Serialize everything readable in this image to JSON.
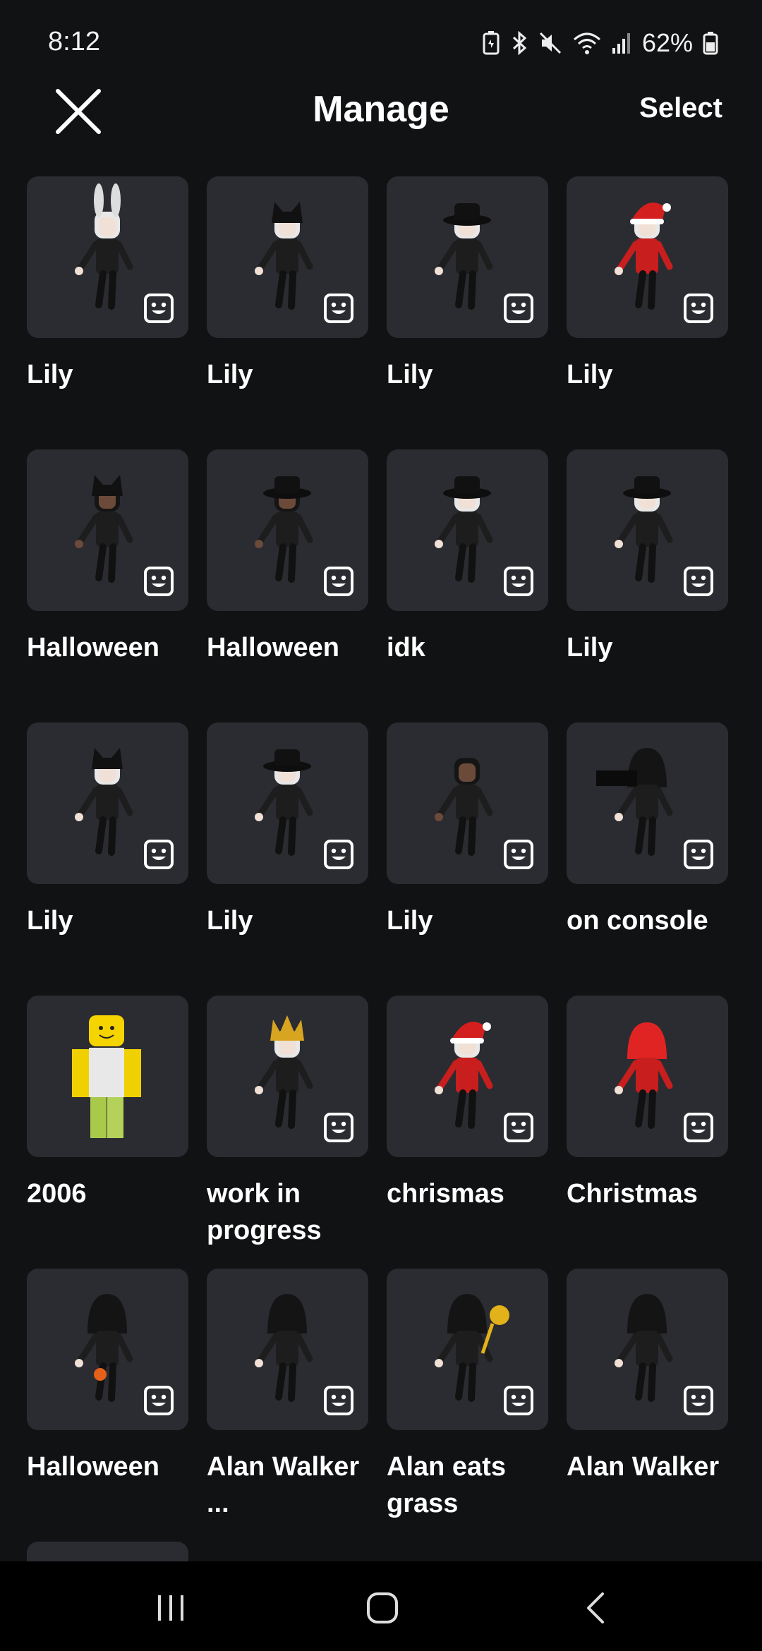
{
  "status": {
    "time": "8:12",
    "battery": "62%"
  },
  "header": {
    "title": "Manage",
    "select_label": "Select"
  },
  "outfits": [
    {
      "name": "Lily",
      "avatar": "bunny-ears-black",
      "emote": true
    },
    {
      "name": "Lily",
      "avatar": "cat-hat-white-hair",
      "emote": true
    },
    {
      "name": "Lily",
      "avatar": "fedora-white-hair",
      "emote": true
    },
    {
      "name": "Lily",
      "avatar": "santa-hat-red",
      "emote": true
    },
    {
      "name": "Halloween",
      "avatar": "cat-hat-dark-hair",
      "emote": true
    },
    {
      "name": "Halloween",
      "avatar": "fedora-dark-hair",
      "emote": true
    },
    {
      "name": "idk",
      "avatar": "fedora-white-hair",
      "emote": true
    },
    {
      "name": "Lily",
      "avatar": "fedora-white-hair",
      "emote": true
    },
    {
      "name": "Lily",
      "avatar": "cat-hat-white-hair",
      "emote": true
    },
    {
      "name": "Lily",
      "avatar": "fedora-white-hair",
      "emote": true
    },
    {
      "name": "Lily",
      "avatar": "ponytail-dark",
      "emote": true
    },
    {
      "name": "on console",
      "avatar": "hood-black-sign",
      "emote": true
    },
    {
      "name": "2006",
      "avatar": "classic-noob",
      "emote": false
    },
    {
      "name": "work in progress",
      "avatar": "gold-crown-black",
      "emote": true
    },
    {
      "name": "chrismas",
      "avatar": "santa-hat-red",
      "emote": true
    },
    {
      "name": "Christmas",
      "avatar": "red-hood",
      "emote": true
    },
    {
      "name": "Halloween",
      "avatar": "hood-black-orange",
      "emote": true
    },
    {
      "name": "Alan Walker ...",
      "avatar": "hood-black",
      "emote": true
    },
    {
      "name": "Alan eats grass",
      "avatar": "hood-black-gold",
      "emote": true
    },
    {
      "name": "Alan Walker",
      "avatar": "hood-black",
      "emote": true
    }
  ],
  "icons": {
    "close": "close-icon",
    "emote": "emote-face-icon",
    "nav_recents": "recents-icon",
    "nav_home": "home-icon",
    "nav_back": "back-icon"
  },
  "colors": {
    "background": "#111214",
    "tile": "#2b2c31",
    "text": "#ffffff"
  }
}
